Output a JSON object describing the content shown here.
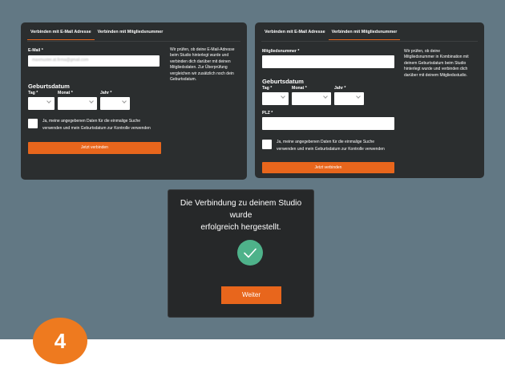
{
  "card_left": {
    "tabs": [
      "Verbinden mit E-Mail Adresse",
      "Verbinden mit Mitgliedsnummer"
    ],
    "email_label": "E-Mail *",
    "email_value": "maxmuster.at.firma@gmail.com",
    "birth_title": "Geburtsdatum",
    "day_label": "Tag *",
    "month_label": "Monat *",
    "year_label": "Jahr *",
    "consent": [
      "Ja, meine angegebenen Daten für die einmalige Suche",
      "verwenden und mein Geburtsdatum zur Kontrolle verwenden"
    ],
    "submit": "Jetzt verbinden",
    "info": [
      "Wir prüfen, ob deine E-Mail-Adresse",
      "beim Studio hinterlegt wurde und",
      "verbinden dich darüber mit deinen",
      "Mitgliedsdaten. Zur Überprüfung",
      "vergleichen wir zusätzlich noch dein",
      "Geburtsdatum."
    ]
  },
  "card_right": {
    "tabs": [
      "Verbinden mit E-Mail Adresse",
      "Verbinden mit Mitgliedsnummer"
    ],
    "member_label": "Mitgliedsnummer *",
    "birth_title": "Geburtsdatum",
    "day_label": "Tag *",
    "month_label": "Monat *",
    "year_label": "Jahr *",
    "zip_label": "PLZ *",
    "consent": [
      "Ja, meine angegebenen Daten für die einmalige Suche",
      "verwenden und mein Geburtsdatum zur Kontrolle verwenden"
    ],
    "submit": "Jetzt verbinden",
    "info": [
      "Wir prüfen, ob deine",
      "Mitgliedsnummer in Kombination mit",
      "deinem Geburtsdatum beim Studio",
      "hinterlegt wurde und verbinden dich",
      "darüber mit deinem Mitgliedsstudio."
    ]
  },
  "modal": {
    "title_lines": [
      "Die Verbindung zu deinem Studio wurde",
      "erfolgreich hergestellt."
    ],
    "check_icon": "checkmark-icon",
    "button": "Weiter"
  },
  "step": {
    "number": "4"
  },
  "colors": {
    "accent": "#e8661c",
    "card": "#2b2e2f",
    "background": "#627884",
    "success": "#4eb28a",
    "badge": "#ee7a1f"
  }
}
